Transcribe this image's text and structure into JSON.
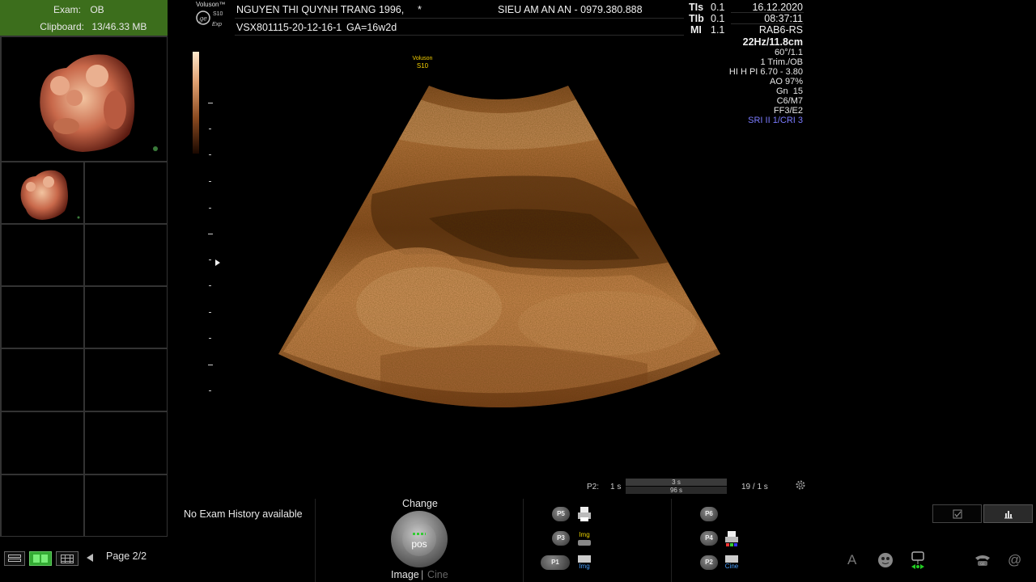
{
  "exam": {
    "label": "Exam:",
    "value": "OB"
  },
  "clipboard": {
    "label": "Clipboard:",
    "value": "13/46.33 MB"
  },
  "logo": {
    "brand": "Voluson™",
    "model": "S10",
    "tag": "Exp",
    "icon": "ge-logo-icon"
  },
  "patient": {
    "name": "NGUYEN THI QUYNH TRANG 1996,",
    "marker": "*",
    "clinic": "SIEU AM AN AN - 0979.380.888",
    "exam_id": "VSX801115-20-12-16-1",
    "ga": "GA=16w2d"
  },
  "params": [
    {
      "label": "TIs",
      "value": "0.1"
    },
    {
      "label": "TIb",
      "value": "0.1"
    },
    {
      "label": "MI",
      "value": "1.1"
    }
  ],
  "datetime": {
    "date": "16.12.2020",
    "time": "08:37:11"
  },
  "probe_info": {
    "probe": "RAB6-RS",
    "freq": "22Hz/11.8cm",
    "angle": "60°/1.1",
    "preset": "1 Trim./OB",
    "harmonics": "HI H PI 6.70 - 3.80",
    "ao": "AO 97%",
    "gain": "Gn  15",
    "c": "C6/M7",
    "ff": "FF3/E2",
    "sri": "SRI II 1/CRI 3"
  },
  "probe_label": {
    "line1": "Voluson",
    "line2": "S10"
  },
  "cine": {
    "label": "P2:",
    "start": "1 s",
    "top": "3 s",
    "bottom": "96 s",
    "count": "19 / 1 s"
  },
  "history": "No Exam History available",
  "change": {
    "label": "Change",
    "knob": "pos",
    "image": "Image",
    "sep": "|",
    "cine": "Cine"
  },
  "page": "Page 2/2",
  "presets_left": [
    {
      "label": "P5",
      "icon": "printer-icon"
    },
    {
      "label": "P3",
      "icon": "img-save-icon",
      "text": "Img"
    },
    {
      "label": "P1",
      "icon": "disk-img-icon",
      "text": "Img"
    }
  ],
  "presets_right": [
    {
      "label": "P6",
      "icon": ""
    },
    {
      "label": "P4",
      "icon": "color-printer-icon"
    },
    {
      "label": "P2",
      "icon": "disk-cine-icon",
      "text": "Cine"
    }
  ],
  "colors": {
    "header_green": "#3c6e1c",
    "sri_blue": "#7b7bff",
    "probe_yellow": "#f5d000",
    "tissue": "#c0783c"
  }
}
